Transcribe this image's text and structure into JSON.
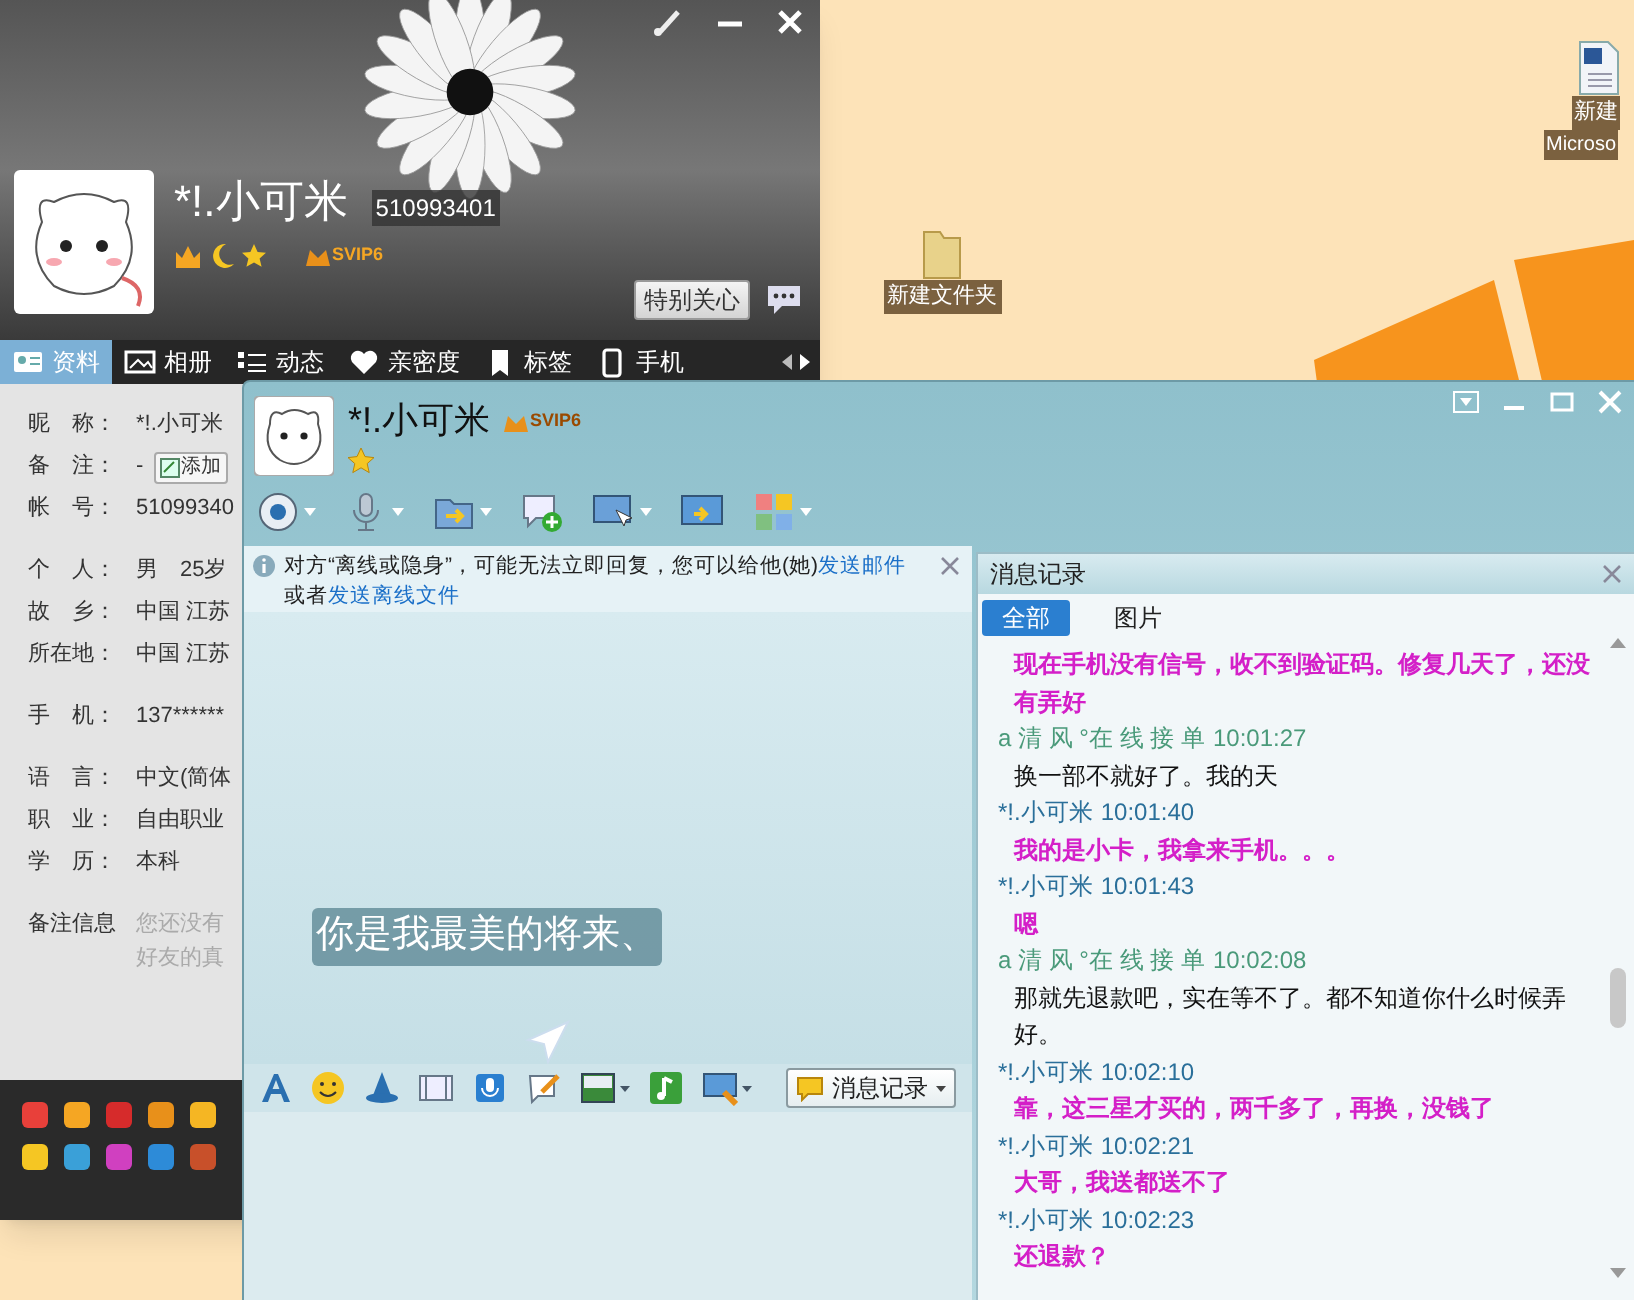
{
  "desktop": {
    "icons": [
      {
        "kind": "folder",
        "label": "新建文件夹"
      },
      {
        "kind": "document",
        "label": "新建",
        "label_2": "Microso"
      }
    ]
  },
  "profile_window": {
    "nickname": "*!.小可米",
    "qq_number": "510993401",
    "vip_badge": "SVIP6",
    "special_care_button": "特别关心",
    "tabs": [
      {
        "label": "资料",
        "selected": true
      },
      {
        "label": "相册",
        "selected": false
      },
      {
        "label": "动态",
        "selected": false
      },
      {
        "label": "亲密度",
        "selected": false
      },
      {
        "label": "标签",
        "selected": false
      },
      {
        "label": "手机",
        "selected": false
      }
    ],
    "field_groups": [
      [
        {
          "label": "昵　称：",
          "value": "*!.小可米"
        },
        {
          "label": "备　注：",
          "value": "-",
          "button": "添加"
        },
        {
          "label": "帐　号：",
          "value": "51099340"
        }
      ],
      [
        {
          "label": "个　人：",
          "value": "男　25岁"
        },
        {
          "label": "故　乡：",
          "value": "中国 江苏"
        },
        {
          "label": "所在地：",
          "value": "中国 江苏"
        }
      ],
      [
        {
          "label": "手　机：",
          "value": "137******"
        }
      ],
      [
        {
          "label": "语　言：",
          "value": "中文(简体"
        },
        {
          "label": "职　业：",
          "value": "自由职业"
        },
        {
          "label": "学　历：",
          "value": "本科"
        }
      ]
    ],
    "remark": {
      "label": "备注信息",
      "lines": [
        "您还没有",
        "好友的真"
      ]
    }
  },
  "chat_window": {
    "contact_name": "*!.小可米",
    "vip_badge": "SVIP6",
    "notice": {
      "text_1": "对方“离线或隐身”，可能无法立即回复，您可以给他(她)",
      "link_1": "发送邮件",
      "text_2": "或者",
      "link_2": "发送离线文件"
    },
    "background_text": "你是我最美的将来、",
    "history_button": "消息记录",
    "history": {
      "title": "消息记录",
      "tabs": [
        {
          "label": "全部",
          "selected": true
        },
        {
          "label": "图片",
          "selected": false
        }
      ],
      "entries": [
        {
          "kind": "self",
          "text": "现在手机没有信号，收不到验证码。修复几天了，还没有弄好"
        },
        {
          "kind": "other",
          "sender": "a  清 风  °在 线 接 单",
          "time": "10:01:27",
          "text": "换一部不就好了。我的天"
        },
        {
          "kind": "self",
          "sender": "*!.小可米",
          "time": "10:01:40",
          "text": "我的是小卡，我拿来手机。。。"
        },
        {
          "kind": "self",
          "sender": "*!.小可米",
          "time": "10:01:43",
          "text": "嗯"
        },
        {
          "kind": "other",
          "sender": "a  清 风  °在 线 接 单",
          "time": "10:02:08",
          "text": "那就先退款吧，实在等不了。都不知道你什么时候弄好。"
        },
        {
          "kind": "self",
          "sender": "*!.小可米",
          "time": "10:02:10",
          "text": "靠，这三星才买的，两千多了，再换，没钱了"
        },
        {
          "kind": "self",
          "sender": "*!.小可米",
          "time": "10:02:21",
          "text": "大哥，我送都送不了"
        },
        {
          "kind": "self",
          "sender": "*!.小可米",
          "time": "10:02:23",
          "text": "还退款？"
        }
      ]
    }
  }
}
